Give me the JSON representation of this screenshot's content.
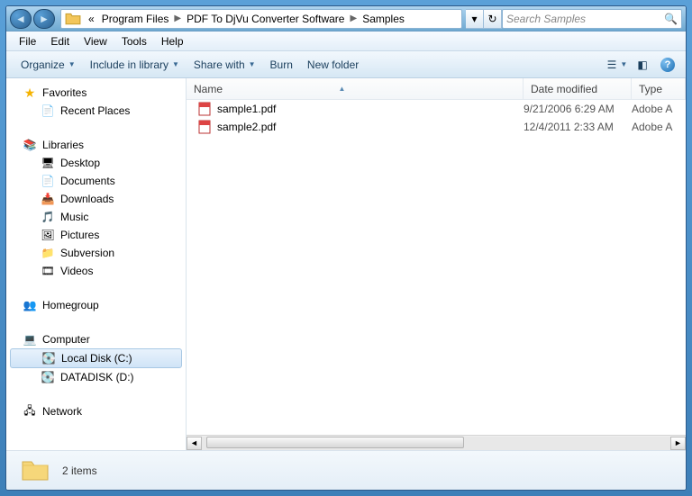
{
  "address": {
    "crumbs_prefix": "«",
    "crumbs": [
      "Program Files",
      "PDF To DjVu Converter Software",
      "Samples"
    ]
  },
  "search": {
    "placeholder": "Search Samples"
  },
  "menubar": [
    "File",
    "Edit",
    "View",
    "Tools",
    "Help"
  ],
  "cmdbar": {
    "organize": "Organize",
    "include": "Include in library",
    "share": "Share with",
    "burn": "Burn",
    "newfolder": "New folder"
  },
  "columns": {
    "name": "Name",
    "date": "Date modified",
    "type": "Type"
  },
  "nav": {
    "favorites": {
      "label": "Favorites",
      "items": [
        "Recent Places"
      ]
    },
    "libraries": {
      "label": "Libraries",
      "items": [
        "Desktop",
        "Documents",
        "Downloads",
        "Music",
        "Pictures",
        "Subversion",
        "Videos"
      ]
    },
    "homegroup": {
      "label": "Homegroup"
    },
    "computer": {
      "label": "Computer",
      "items": [
        "Local Disk (C:)",
        "DATADISK (D:)"
      ],
      "selected_index": 0
    },
    "network": {
      "label": "Network"
    }
  },
  "files": [
    {
      "name": "sample1.pdf",
      "date": "9/21/2006 6:29 AM",
      "type": "Adobe A"
    },
    {
      "name": "sample2.pdf",
      "date": "12/4/2011 2:33 AM",
      "type": "Adobe A"
    }
  ],
  "details": {
    "count_label": "2 items"
  }
}
